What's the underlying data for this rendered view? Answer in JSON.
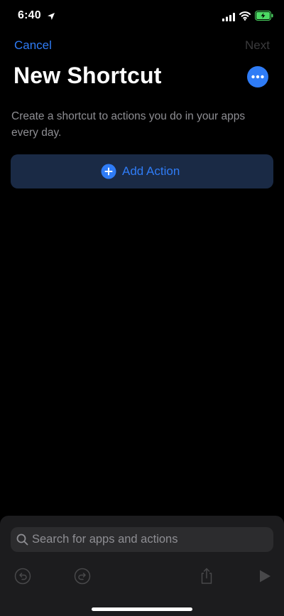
{
  "status_bar": {
    "time": "6:40",
    "icons": [
      "location-icon",
      "signal-icon",
      "wifi-icon",
      "battery-charging-icon"
    ]
  },
  "nav": {
    "cancel_label": "Cancel",
    "next_label": "Next"
  },
  "title": "New Shortcut",
  "description": "Create a shortcut to actions you do in your apps every day.",
  "add_action": {
    "label": "Add Action",
    "icon": "plus-circle-icon"
  },
  "search": {
    "placeholder": "Search for apps and actions",
    "icon": "search-icon"
  },
  "toolbar": {
    "icons": [
      "undo-icon",
      "redo-icon",
      "share-icon",
      "play-icon"
    ]
  },
  "colors": {
    "background": "#000000",
    "accent": "#2f7cf6",
    "disabled_text": "#3a3a3c",
    "secondary_text": "#8e8e93",
    "add_action_bg": "#1a2a45",
    "panel_bg": "#1c1c1e",
    "search_bg": "#2c2c2e",
    "battery_green": "#4cd964"
  }
}
